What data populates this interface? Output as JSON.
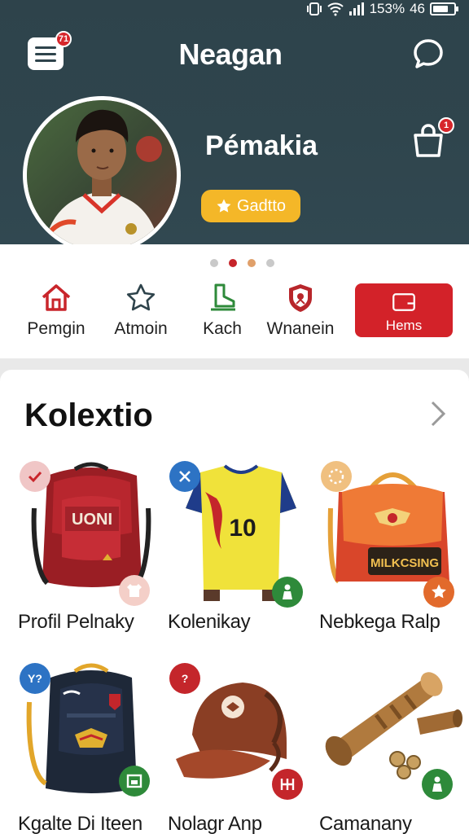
{
  "status_bar": {
    "battery_percent": "153%",
    "network": "46"
  },
  "header": {
    "title": "Neagan",
    "menu_badge": "71",
    "bag_badge": "1"
  },
  "profile": {
    "name": "Pémakia",
    "button_label": "Gadtto"
  },
  "carousel": {
    "count": 4,
    "active_index": 1
  },
  "nav": [
    {
      "label": "Pemgin",
      "icon": "home-icon"
    },
    {
      "label": "Atmoin",
      "icon": "star-icon"
    },
    {
      "label": "Kach",
      "icon": "shoe-icon"
    },
    {
      "label": "Wnanein",
      "icon": "club-crest-icon"
    },
    {
      "label": "Hems",
      "icon": "wallet-icon"
    }
  ],
  "collection": {
    "title": "Kolextio",
    "items": [
      {
        "name": "Profil Pelnaky",
        "print_text": "UONI",
        "icon": "backpack-icon"
      },
      {
        "name": "Kolenikay",
        "print_text": "10",
        "icon": "jersey-icon"
      },
      {
        "name": "Nebkega Ralp",
        "print_text": "MILKCSING",
        "icon": "shoulder-bag-icon"
      },
      {
        "name": "Kgalte Di Iteen",
        "print_text": "",
        "icon": "backpack-icon"
      },
      {
        "name": "Nolagr Anp",
        "print_text": "",
        "icon": "cap-icon"
      },
      {
        "name": "Camanany",
        "print_text": "",
        "icon": "horn-icon"
      }
    ],
    "tags": [
      "Y?",
      "?"
    ]
  },
  "colors": {
    "header_bg": "#2e434b",
    "accent_red": "#d32229",
    "gold": "#f4b728"
  }
}
